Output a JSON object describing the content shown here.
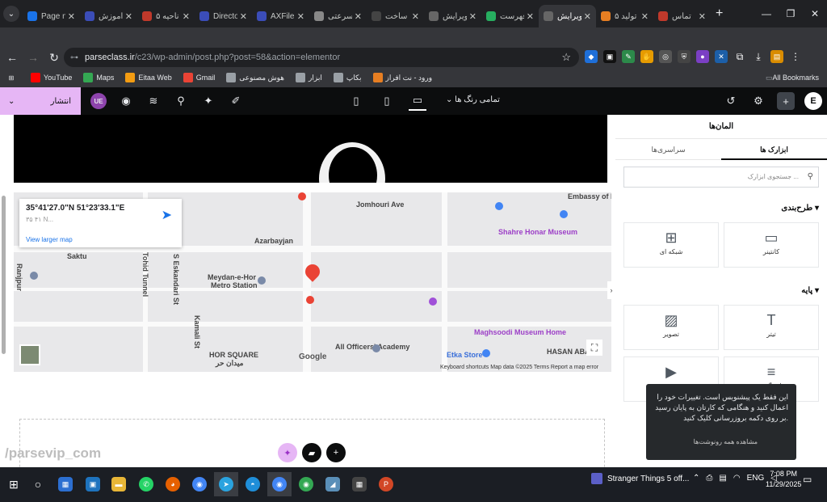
{
  "browser": {
    "tabs": [
      {
        "title": "Page n",
        "color": "#1a73e8",
        "active": false
      },
      {
        "title": "آموزش",
        "color": "#3b4db8",
        "active": false
      },
      {
        "title": "ناحیه ۵",
        "color": "#c0392b",
        "active": false
      },
      {
        "title": "Directo",
        "color": "#3b4db8",
        "active": false
      },
      {
        "title": "AXFile",
        "color": "#3b4db8",
        "active": false
      },
      {
        "title": "سرعتی",
        "color": "#888888",
        "active": false
      },
      {
        "title": "ساخت",
        "color": "#444444",
        "active": false
      },
      {
        "title": "ویرایش",
        "color": "#666666",
        "active": false
      },
      {
        "title": "فهرست",
        "color": "#27ae60",
        "active": false
      },
      {
        "title": "ویرایش",
        "color": "#666666",
        "active": true
      },
      {
        "title": "تولید ۵",
        "color": "#e67e22",
        "active": false
      },
      {
        "title": "تماس",
        "color": "#c0392b",
        "active": false
      }
    ],
    "new_tab": "+",
    "url_host": "parseclass.ir",
    "url_path": "/c23/wp-admin/post.php?post=58&action=elementor",
    "bookmarks": [
      {
        "label": "YouTube",
        "icon": "youtube-icon",
        "color": "#ff0000"
      },
      {
        "label": "Maps",
        "icon": "maps-icon",
        "color": "#34a853"
      },
      {
        "label": "Eitaa Web",
        "icon": "eitaa-icon",
        "color": "#f39c12"
      },
      {
        "label": "Gmail",
        "icon": "gmail-icon",
        "color": "#ea4335"
      },
      {
        "label": "هوش مصنوعی",
        "icon": "folder-icon",
        "color": "#9aa0a6"
      },
      {
        "label": "ابزار",
        "icon": "folder-icon",
        "color": "#9aa0a6"
      },
      {
        "label": "بکاپ",
        "icon": "folder-icon",
        "color": "#9aa0a6"
      },
      {
        "label": "ورود - نت افراز",
        "icon": "net-icon",
        "color": "#e67e22"
      }
    ],
    "all_bookmarks": "All Bookmarks"
  },
  "elementor": {
    "publish_label": "انتشار",
    "device_select": "تمامی رنگ ها",
    "ue_badge": "UE"
  },
  "map": {
    "coords": "35°41'27.0\"N 51°23'33.1\"E",
    "coords_sub": "۳۵ ۴۱ N...",
    "view_larger": "View larger map",
    "streets": [
      {
        "t": "Jomhouri Ave"
      },
      {
        "t": "Azarbayjan"
      },
      {
        "t": "Meydan-e-Hor"
      },
      {
        "t": "Metro Station"
      },
      {
        "t": "Etka Store"
      },
      {
        "t": "HOR SQUARE"
      },
      {
        "t": "میدان حر"
      },
      {
        "t": "Tohid Tunnel"
      },
      {
        "t": "S Eskandari St"
      },
      {
        "t": "Kamali St"
      },
      {
        "t": "HASAN ABAD"
      },
      {
        "t": "Embassy of I"
      },
      {
        "t": "Saktu"
      },
      {
        "t": "Ranjpur"
      },
      {
        "t": "All Officers' Academy"
      }
    ],
    "pois": [
      {
        "t": "Maghsoodi Museum Home"
      },
      {
        "t": "Shahre Honar Museum"
      }
    ],
    "footer": "Keyboard shortcuts   Map data ©2025   Terms   Report a map error",
    "google": "Google"
  },
  "panel": {
    "title": "المان‌ها",
    "tabs": [
      "ابزارک ها",
      "سراسری‌ها"
    ],
    "search_placeholder": "جستجوی ابزارک ...",
    "section_layout": "طرح‌بندی",
    "section_basic": "پایه",
    "widgets": [
      {
        "label": "کانتینر",
        "icon": "container-icon"
      },
      {
        "label": "شبکه ای",
        "icon": "grid-icon"
      },
      {
        "label": "تیتر",
        "icon": "heading-icon"
      },
      {
        "label": "تصویر",
        "icon": "image-icon"
      },
      {
        "label": "ویرایشگر متن",
        "icon": "text-editor-icon"
      },
      {
        "label": "ویدیو",
        "icon": "video-icon"
      }
    ]
  },
  "toast": {
    "text": "این فقط یک پیشنویس است. تغییرات خود را اعمال کنید و هنگامی که کارتان به پایان رسید بر روی دکمه بروزرسانی کلیک کنید.",
    "footer": "مشاهده همه رونوشت‌ها"
  },
  "watermark": "/parsevip_com",
  "taskbar": {
    "music": "Stranger Things 5 off...",
    "lang": "ENG",
    "time": "7:08 PM",
    "date": "11/29/2025"
  }
}
